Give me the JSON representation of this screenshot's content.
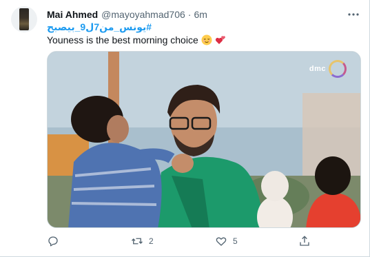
{
  "tweet": {
    "display_name": "Mai Ahmed",
    "handle": "@mayoyahmad706",
    "separator": "·",
    "time": "6m",
    "hashtag": "#يونس_من7ل9_بيصبح",
    "text": "Youness is the best morning choice"
  },
  "media": {
    "logo_text": "dmc"
  },
  "actions": {
    "retweet_count": "2",
    "like_count": "5"
  },
  "icons": {
    "more": "more-icon",
    "reply": "reply-icon",
    "retweet": "retweet-icon",
    "like": "like-icon",
    "share": "share-icon",
    "emoji1": "relieved-face-emoji",
    "emoji2": "revolving-hearts-emoji"
  },
  "colors": {
    "link": "#1d9bf0",
    "secondary_text": "#536471",
    "primary_text": "#0f1419"
  }
}
